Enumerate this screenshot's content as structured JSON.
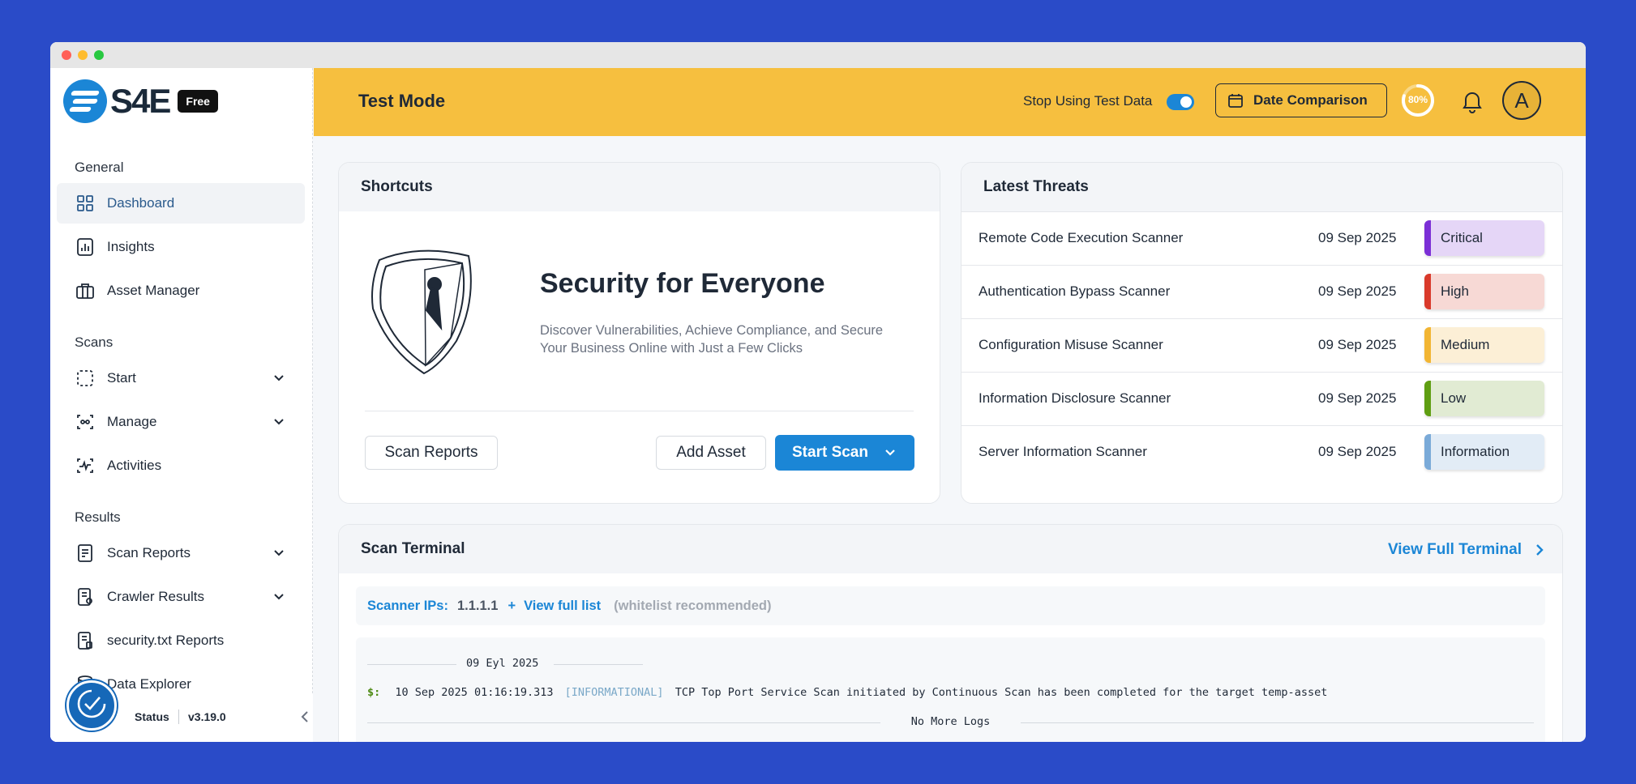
{
  "brand": {
    "name": "S4E",
    "plan_badge": "Free"
  },
  "sidebar": {
    "sections": {
      "general": "General",
      "scans": "Scans",
      "results": "Results"
    },
    "items": [
      {
        "label": "Dashboard"
      },
      {
        "label": "Insights"
      },
      {
        "label": "Asset Manager"
      },
      {
        "label": "Start"
      },
      {
        "label": "Manage"
      },
      {
        "label": "Activities"
      },
      {
        "label": "Scan Reports"
      },
      {
        "label": "Crawler Results"
      },
      {
        "label": "security.txt Reports"
      },
      {
        "label": "Data Explorer"
      }
    ],
    "footer": {
      "status": "Status",
      "version": "v3.19.0"
    }
  },
  "header": {
    "title": "Test Mode",
    "toggle_label": "Stop Using Test Data",
    "date_comparison": "Date Comparison",
    "progress_label": "80%",
    "progress_value": 0.8,
    "avatar_initial": "A"
  },
  "shortcuts": {
    "title": "Shortcuts",
    "headline": "Security for Everyone",
    "description": "Discover Vulnerabilities, Achieve Compliance, and Secure Your Business Online with Just a Few Clicks",
    "scan_reports": "Scan Reports",
    "add_asset": "Add Asset",
    "start_scan": "Start Scan"
  },
  "threats": {
    "title": "Latest Threats",
    "rows": [
      {
        "name": "Remote Code Execution Scanner",
        "date": "09 Sep 2025",
        "severity": "Critical",
        "bar": "#7b2fd6",
        "bg": "#e5d6f7"
      },
      {
        "name": "Authentication Bypass Scanner",
        "date": "09 Sep 2025",
        "severity": "High",
        "bar": "#d93a2b",
        "bg": "#f7d9d5"
      },
      {
        "name": "Configuration Misuse Scanner",
        "date": "09 Sep 2025",
        "severity": "Medium",
        "bar": "#f2b533",
        "bg": "#fcefd6"
      },
      {
        "name": "Information Disclosure Scanner",
        "date": "09 Sep 2025",
        "severity": "Low",
        "bar": "#5f9e12",
        "bg": "#e1ebd3"
      },
      {
        "name": "Server Information Scanner",
        "date": "09 Sep 2025",
        "severity": "Information",
        "bar": "#7aaad8",
        "bg": "#e2ecf6"
      }
    ]
  },
  "terminal": {
    "title": "Scan Terminal",
    "view_full": "View Full Terminal",
    "scanner_ips_label": "Scanner IPs:",
    "scanner_ip": "1.1.1.1",
    "plus": "+",
    "view_full_list": "View full list",
    "whitelist_note": "(whitelist recommended)",
    "date_divider": "09 Eyl 2025",
    "log_prompt": "$:",
    "log_time": "10 Sep 2025 01:16:19.313",
    "log_level": "[INFORMATIONAL]",
    "log_message": "TCP Top Port Service Scan initiated by Continuous Scan has been completed for the target temp-asset",
    "no_more": "No More Logs"
  }
}
